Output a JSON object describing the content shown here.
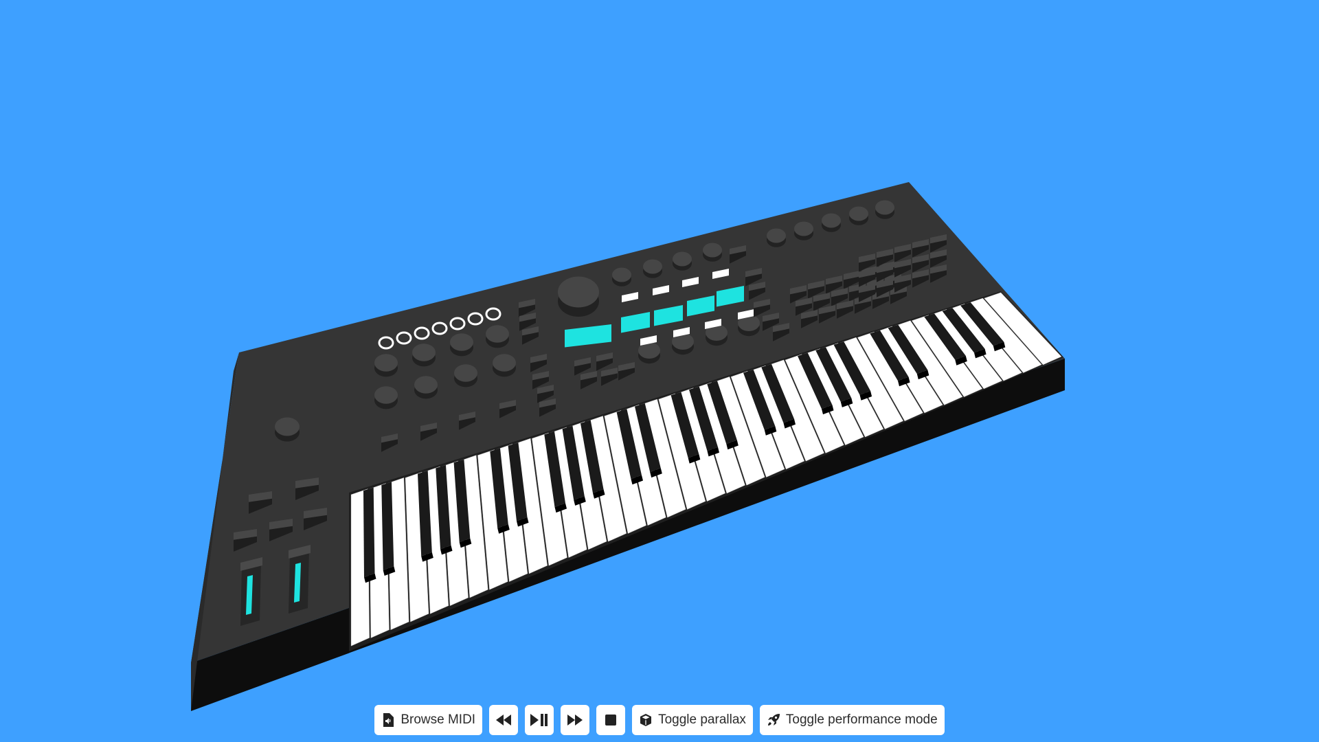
{
  "scene": {
    "background_color": "#3ea0ff",
    "object": "midi-keyboard-3d",
    "body_color": "#353535",
    "pad_color": "#1ee3e0",
    "white_key_color": "#ffffff",
    "black_key_color": "#1a1a1a",
    "white_key_count": 36,
    "illuminated_pads": 5,
    "faders": 2
  },
  "toolbar": {
    "browse_midi": {
      "label": "Browse MIDI",
      "icon": "file-audio-icon"
    },
    "rewind": {
      "icon": "backward-icon"
    },
    "play_pause": {
      "icon": "play-pause-icon"
    },
    "fast_forward": {
      "icon": "forward-icon"
    },
    "stop": {
      "icon": "stop-icon"
    },
    "toggle_parallax": {
      "label": "Toggle parallax",
      "icon": "cube-icon"
    },
    "toggle_performance": {
      "label": "Toggle performance mode",
      "icon": "rocket-icon"
    }
  }
}
